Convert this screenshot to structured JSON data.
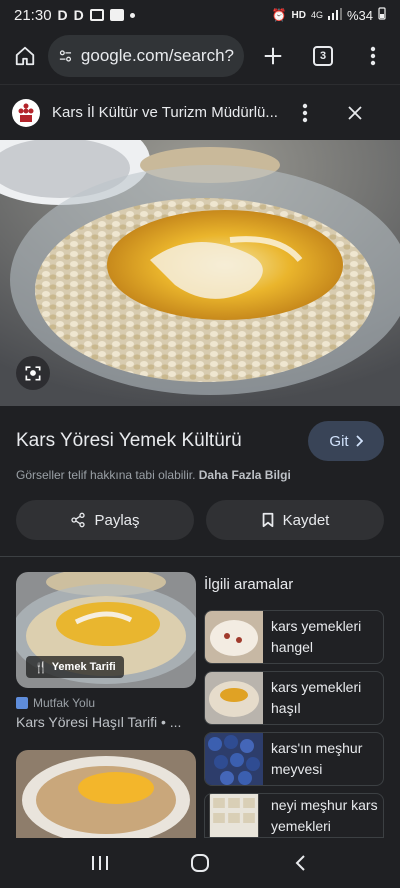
{
  "status": {
    "time": "21:30",
    "network": "4G",
    "battery": "%34",
    "icons": [
      "d-app-icon",
      "d-app-icon",
      "media-icon",
      "check-icon",
      "dot-icon",
      "alarm-icon",
      "hd-icon",
      "signal-icon",
      "battery-icon"
    ]
  },
  "browser": {
    "url": "google.com/search?",
    "tab_count": "3"
  },
  "source": {
    "title": "Kars İl Kültür ve Turizm Müdürlü..."
  },
  "result": {
    "title": "Kars Yöresi Yemek Kültürü",
    "visit_label": "Git",
    "copyright_text": "Görseller telif hakkına tabi olabilir.",
    "more_info": "Daha Fazla Bilgi",
    "share_label": "Paylaş",
    "save_label": "Kaydet"
  },
  "cards": [
    {
      "badge": "Yemek Tarifi",
      "source": "Mutfak Yolu",
      "title": "Kars Yöresi Haşıl Tarifi • ..."
    }
  ],
  "related": {
    "heading": "İlgili aramalar",
    "items": [
      {
        "line1": "kars yemekleri",
        "line2": "hangel"
      },
      {
        "line1": "kars yemekleri",
        "line2": "haşıl"
      },
      {
        "line1": "kars'ın meşhur",
        "line2": "meyvesi"
      },
      {
        "line1": "neyi meşhur kars",
        "line2": "yemekleri"
      }
    ]
  },
  "colors": {
    "background": "#1f2023",
    "pill": "#313437",
    "visit_button": "#394457",
    "accent_text": "#d2e3fc"
  }
}
